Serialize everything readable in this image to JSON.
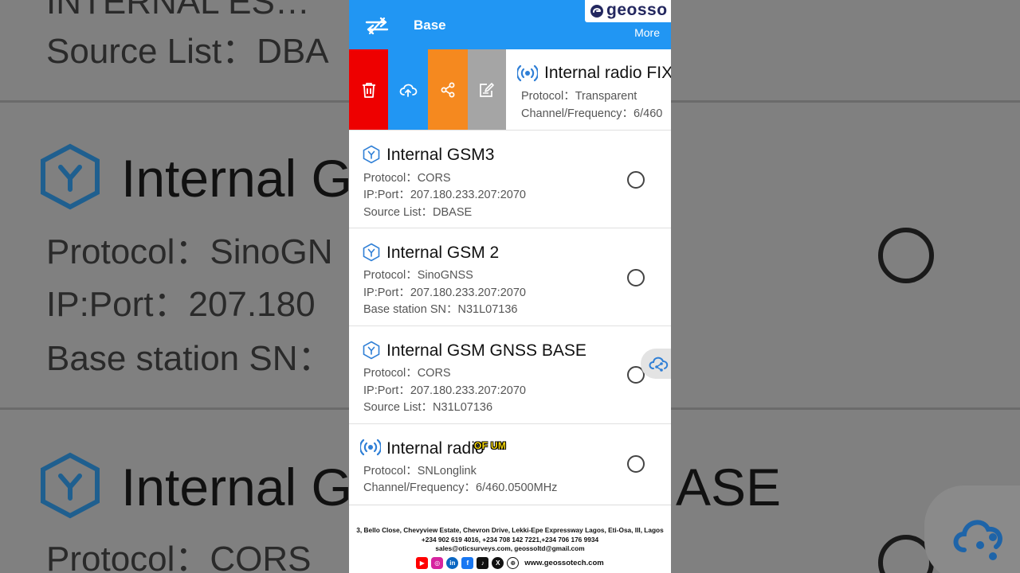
{
  "app_bar": {
    "title": "Base",
    "more_label": "More",
    "logo_text": "geosso"
  },
  "swipe_actions": {
    "delete_icon": "trash-icon",
    "upload_icon": "cloud-upload-icon",
    "share_icon": "share-icon",
    "edit_icon": "edit-icon"
  },
  "swiped_item": {
    "title": "Internal radio FIX",
    "protocol": "Protocol：Transparent",
    "channel": "Channel/Frequency：6/460"
  },
  "items": [
    {
      "title": "Internal GSM3",
      "line1": "Protocol：CORS",
      "line2": "IP:Port：207.180.233.207:2070",
      "line3": "Source List：DBASE",
      "icon": "gsm-antenna-icon"
    },
    {
      "title": "Internal GSM 2",
      "line1": "Protocol：SinoGNSS",
      "line2": "IP:Port：207.180.233.207:2070",
      "line3": "Base station SN：N31L07136",
      "icon": "gsm-antenna-icon"
    },
    {
      "title": "Internal GSM GNSS BASE",
      "line1": "Protocol：CORS",
      "line2": "IP:Port：207.180.233.207:2070",
      "line3": "Source List：N31L07136",
      "icon": "gsm-antenna-icon"
    },
    {
      "title": "Internal radio",
      "line1": "Protocol：SNLonglink",
      "line2": "Channel/Frequency：6/460.0500MHz",
      "icon": "radio-signal-icon"
    }
  ],
  "caption": "OF UM",
  "footer": {
    "address": "3, Bello Close, Chevyview Estate, Chevron Drive, Lekki-Epe Expressway Lagos, Eti-Osa, III, Lagos",
    "phones": "+234 902 619 4016, +234 708 142 7221,+234 706 176 9934",
    "emails": "sales@oticsurveys.com, geossoltd@gmail.com",
    "website": "www.geossotech.com"
  },
  "background": {
    "top_line": "Source List：DBA",
    "title_1": "Internal G",
    "line_protocol": "Protocol：SinoGN",
    "line_ip": "IP:Port：207.180",
    "line_sn": "Base station SN：",
    "title_2": "Internal G",
    "title_2_right": "ASE",
    "line_protocol_2": "Protocol：CORS"
  },
  "colors": {
    "app_bar": "#2196f3",
    "delete": "#ee0000",
    "upload": "#2196f3",
    "share": "#f5891f",
    "edit": "#a5a5a5",
    "icon_blue": "#2f7fd6"
  }
}
